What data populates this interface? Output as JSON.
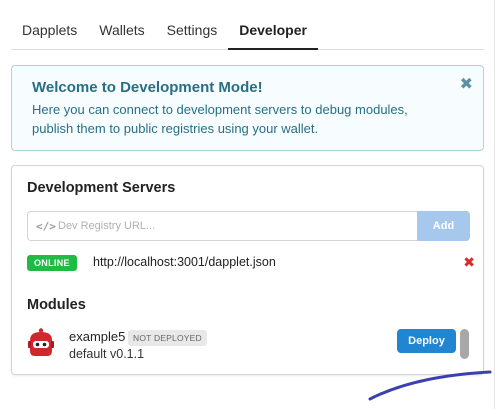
{
  "tabs": [
    {
      "label": "Dapplets"
    },
    {
      "label": "Wallets"
    },
    {
      "label": "Settings"
    },
    {
      "label": "Developer",
      "active": true
    }
  ],
  "welcome": {
    "title": "Welcome to Development Mode!",
    "text": "Here you can connect to development servers to debug modules, publish them to public registries using your wallet.",
    "close_icon": "close-icon"
  },
  "dev_servers": {
    "title": "Development Servers",
    "input": {
      "placeholder": "Dev Registry URL...",
      "value": "",
      "icon": "code-icon"
    },
    "add_label": "Add",
    "servers": [
      {
        "status": "ONLINE",
        "url": "http://localhost:3001/dapplet.json"
      }
    ]
  },
  "modules": {
    "title": "Modules",
    "items": [
      {
        "name": "example5",
        "status": "NOT DEPLOYED",
        "version": "default v0.1.1",
        "action_label": "Deploy"
      }
    ]
  },
  "colors": {
    "accent": "#2185d0",
    "online": "#21ba45",
    "remove": "#db2828",
    "welcome_text": "#276f86",
    "avatar": "#d0282e",
    "pen": "#3d3fb0"
  }
}
